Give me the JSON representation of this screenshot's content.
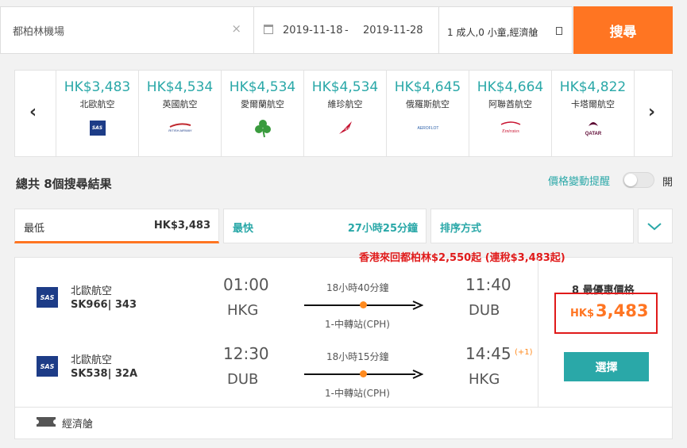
{
  "search": {
    "destination": "都柏林機場",
    "clear_icon": "×",
    "depart_date": "2019-11-18",
    "date_sep": "-",
    "return_date": "2019-11-28",
    "passengers": "1 成人,0 小童,經濟艙",
    "search_label": "搜尋"
  },
  "carousel": {
    "airlines": [
      {
        "price": "HK$3,483",
        "name": "北歐航空",
        "logo": "SAS"
      },
      {
        "price": "HK$4,534",
        "name": "英國航空",
        "logo": "BRITISH AIRWAYS"
      },
      {
        "price": "HK$4,534",
        "name": "愛爾蘭航空",
        "logo": "shamrock"
      },
      {
        "price": "HK$4,534",
        "name": "維珍航空",
        "logo": "Virgin"
      },
      {
        "price": "HK$4,645",
        "name": "俄羅斯航空",
        "logo": "AEROFLOT"
      },
      {
        "price": "HK$4,664",
        "name": "阿聯酋航空",
        "logo": "Emirates"
      },
      {
        "price": "HK$4,822",
        "name": "卡塔爾航空",
        "logo": "QATAR"
      }
    ]
  },
  "summary": {
    "total": "總共 8個搜尋結果",
    "alert_label": "價格變動提醒",
    "alert_state": "開"
  },
  "sort": {
    "cheapest_label": "最低",
    "cheapest_value": "HK$3,483",
    "fastest_label": "最快",
    "fastest_value": "27小時25分鐘",
    "order_label": "排序方式"
  },
  "promo": "香港來回都柏林$2,550起 (連稅$3,483起)",
  "result": {
    "legs": [
      {
        "airline": "北歐航空",
        "flight": "SK966| 343",
        "dep_time": "01:00",
        "dep_code": "HKG",
        "duration": "18小時40分鐘",
        "stops": "1-中轉站(CPH)",
        "arr_time": "11:40",
        "arr_code": "DUB",
        "day_offset": ""
      },
      {
        "airline": "北歐航空",
        "flight": "SK538| 32A",
        "dep_time": "12:30",
        "dep_code": "DUB",
        "duration": "18小時15分鐘",
        "stops": "1-中轉站(CPH)",
        "arr_time": "14:45",
        "arr_code": "HKG",
        "day_offset": "(+1)"
      }
    ],
    "best_label": "8 最優惠價格",
    "currency": "HK$",
    "amount": "3,483",
    "select_label": "選擇",
    "cabin": "經濟艙"
  },
  "colors": {
    "accent": "#ff7522",
    "teal": "#2aa8a8",
    "highlight": "#e01a1a"
  }
}
